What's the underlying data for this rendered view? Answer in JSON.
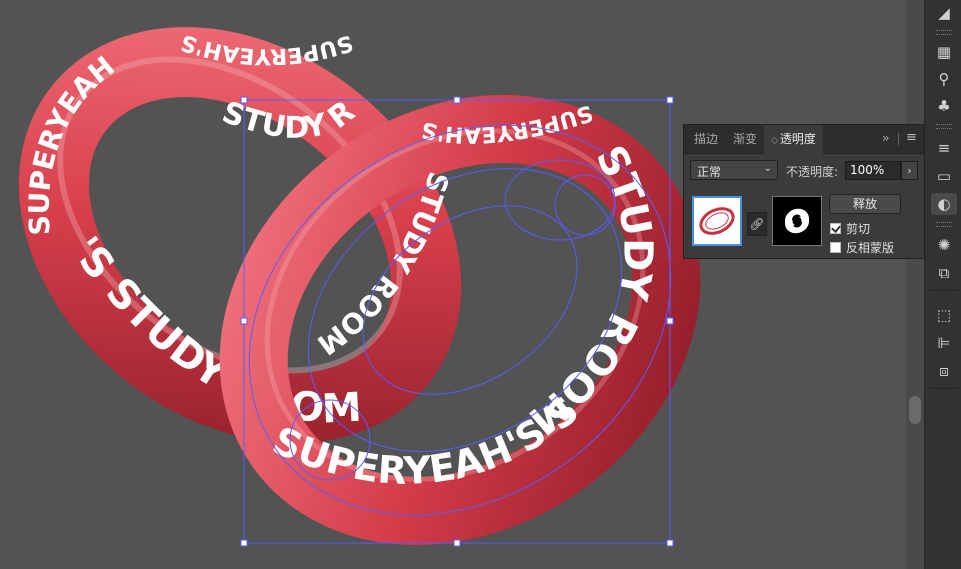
{
  "artwork": {
    "ring_text": "SUPERYEAH'S STUDY ROOM",
    "ring_fragments": {
      "left_ring_bottom": "'S STUDY ROOM",
      "left_ring_left": "SUPERYEAH",
      "left_ring_top": "SUPERYEAH'S",
      "left_ring_inner": "STUDY ROOM",
      "right_ring_right": "STUDY ROOM",
      "right_ring_bottom": "SUPERYEAH'S STUDY",
      "right_ring_top": "SUPERYEAH'S",
      "right_ring_inner": "STUDY ROOM"
    },
    "ring_color": "#d8404c",
    "text_color": "#ffffff",
    "selection_color": "#5b5bff"
  },
  "transparency_panel": {
    "tabs": [
      {
        "label": "描边",
        "active": false
      },
      {
        "label": "渐变",
        "active": false
      },
      {
        "label": "透明度",
        "active": true
      }
    ],
    "collapse_glyph": "››",
    "menu_glyph": "≡",
    "blend_mode": "正常",
    "opacity_label": "不透明度:",
    "opacity_value": "100%",
    "release_label": "释放",
    "clip_label": "剪切",
    "clip_checked": true,
    "invert_label": "反相蒙版",
    "invert_checked": false
  },
  "dock": {
    "buttons": [
      {
        "icon": "gradient-panel-icon"
      },
      {
        "icon": "swatches-panel-icon"
      },
      {
        "icon": "brushes-panel-icon"
      },
      {
        "icon": "symbols-panel-icon"
      },
      {
        "icon": "stroke-panel-icon"
      },
      {
        "icon": "gradient-swatch-icon"
      },
      {
        "icon": "transparency-panel-icon"
      },
      {
        "icon": "appearance-panel-icon"
      },
      {
        "icon": "graphic-styles-icon"
      },
      {
        "icon": "transform-panel-icon"
      },
      {
        "icon": "align-panel-icon"
      },
      {
        "icon": "pathfinder-panel-icon"
      }
    ]
  }
}
